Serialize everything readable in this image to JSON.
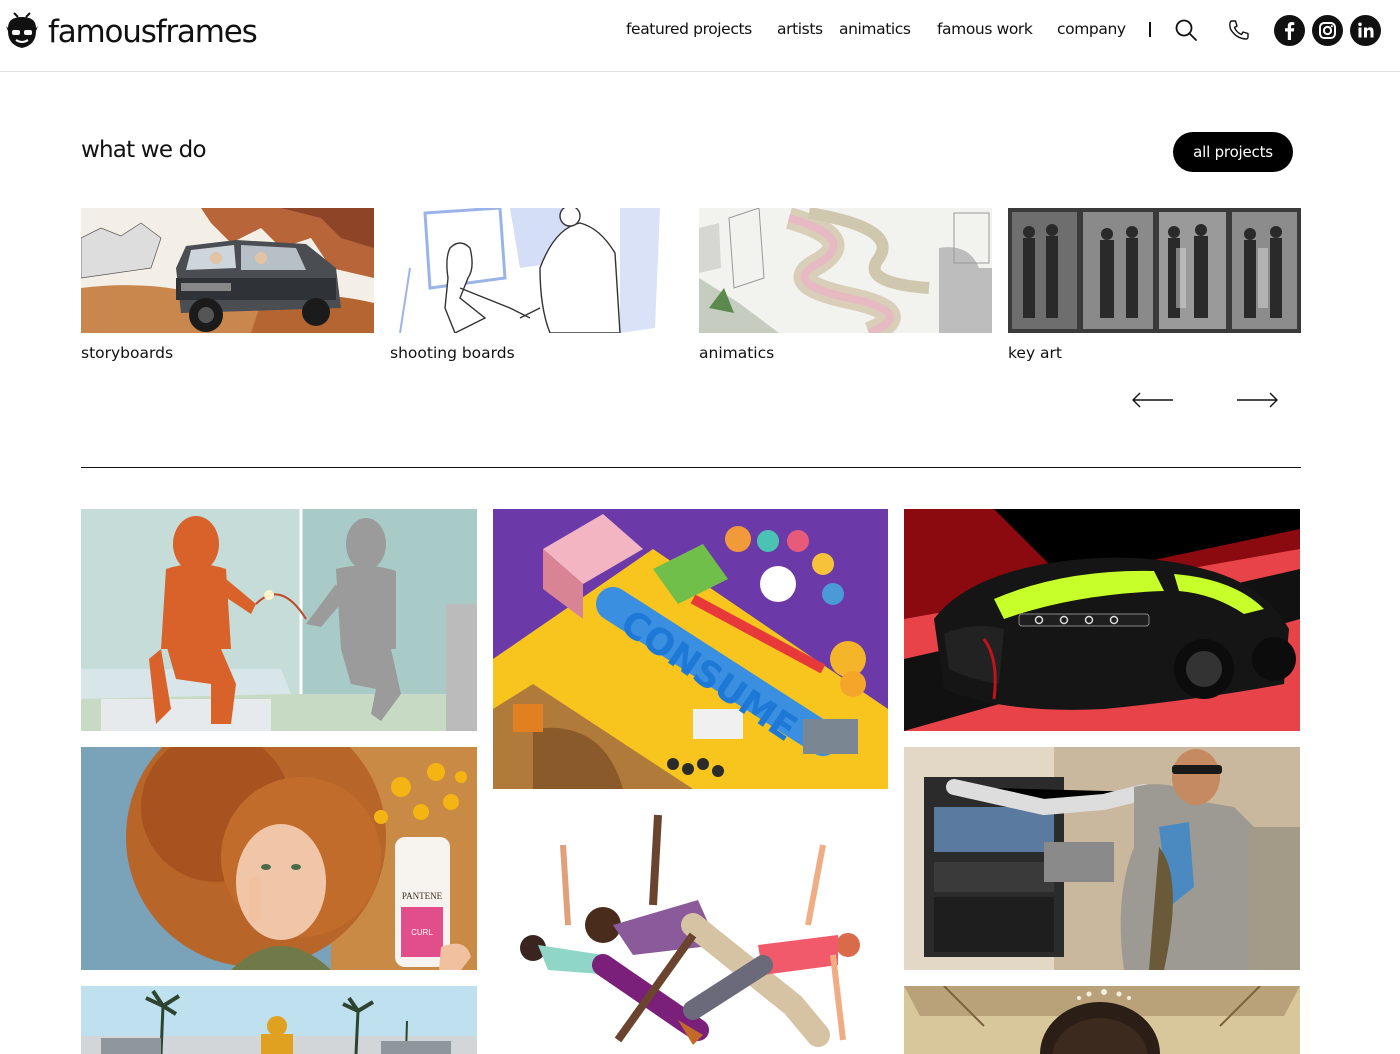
{
  "brand": {
    "name": "famousframes"
  },
  "nav": {
    "items": [
      {
        "label": "featured projects"
      },
      {
        "label": "artists"
      },
      {
        "label": "animatics"
      },
      {
        "label": "famous work"
      },
      {
        "label": "company"
      }
    ],
    "separator": "|",
    "icons": [
      "search-icon",
      "phone-icon"
    ],
    "social": [
      "facebook-icon",
      "instagram-icon",
      "linkedin-icon"
    ]
  },
  "section": {
    "title": "what we do",
    "button": "all projects"
  },
  "services": [
    {
      "label": "storyboards"
    },
    {
      "label": "shooting boards"
    },
    {
      "label": "animatics"
    },
    {
      "label": "key art"
    }
  ],
  "carousel": {
    "prev": "left-arrow-icon",
    "next": "right-arrow-icon"
  },
  "projects": {
    "consume_word": "CONSUME",
    "pantene_brand": "PANTENE",
    "pantene_line": "CURL"
  },
  "colors": {
    "text": "#111111",
    "button_bg": "#000000",
    "button_text": "#ffffff",
    "consume_bg": "#6b3aa8",
    "consume_yellow": "#f7c51e",
    "car_red": "#e9434a"
  }
}
